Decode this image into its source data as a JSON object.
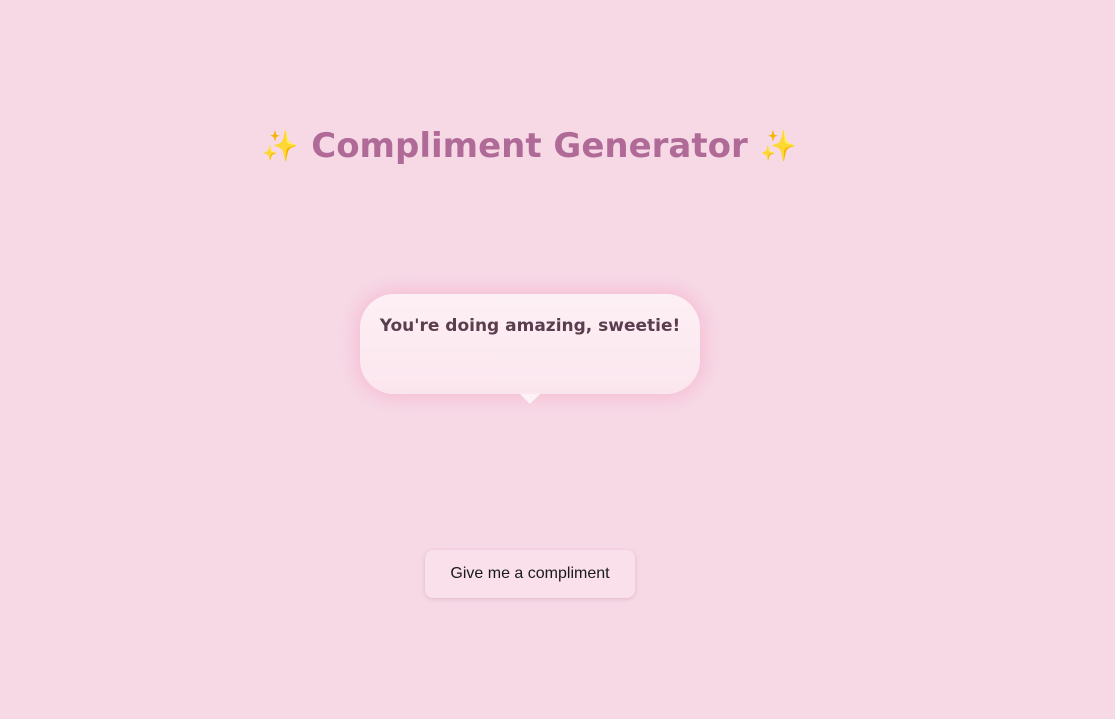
{
  "header": {
    "title": "Compliment Generator",
    "sparkle_left": "✨",
    "sparkle_right": "✨"
  },
  "bubble": {
    "message": "You're doing amazing, sweetie!"
  },
  "actions": {
    "generate_label": "Give me a compliment"
  },
  "colors": {
    "background": "#f7d9e6",
    "title": "#b06a98",
    "bubble_text": "#5a3e4e",
    "button": "#f9e0ea"
  }
}
